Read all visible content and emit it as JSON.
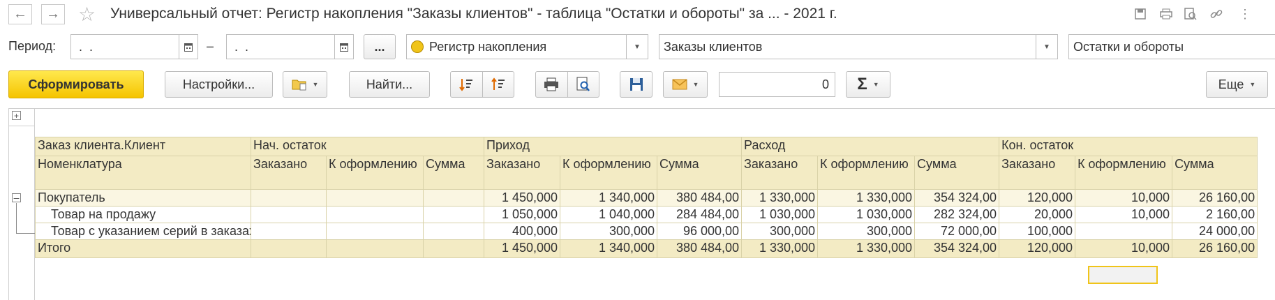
{
  "window": {
    "title": "Универсальный отчет: Регистр накопления \"Заказы клиентов\" - таблица \"Остатки и обороты\" за ... - 2021 г.",
    "back_icon": "arrow-left-icon",
    "forward_icon": "arrow-right-icon",
    "favorite_icon": "star-icon"
  },
  "period": {
    "label": "Период:",
    "from": " .  .",
    "separator": "–",
    "to": " .  .",
    "more_label": "..."
  },
  "source": {
    "type_value": "Регистр накопления",
    "register_value": "Заказы клиентов",
    "table_value": "Остатки и обороты"
  },
  "toolbar": {
    "generate_label": "Сформировать",
    "settings_label": "Настройки...",
    "find_label": "Найти...",
    "sum_value": "0",
    "sigma": "Σ",
    "more_label": "Еще"
  },
  "report": {
    "header1": [
      "Заказ клиента.Клиент",
      "Нач. остаток",
      "Приход",
      "Расход",
      "Кон. остаток"
    ],
    "header2": [
      "Номенклатура",
      "Заказано",
      "К оформлению",
      "Сумма",
      "Заказано",
      "К оформлению",
      "Сумма",
      "Заказано",
      "К оформлению",
      "Сумма",
      "Заказано",
      "К оформлению",
      "Сумма"
    ],
    "group": {
      "name": "Покупатель",
      "values": [
        "",
        "",
        "",
        "1 450,000",
        "1 340,000",
        "380 484,00",
        "1 330,000",
        "1 330,000",
        "354 324,00",
        "120,000",
        "10,000",
        "26 160,00"
      ]
    },
    "rows": [
      {
        "name": "Товар на продажу",
        "values": [
          "",
          "",
          "",
          "1 050,000",
          "1 040,000",
          "284 484,00",
          "1 030,000",
          "1 030,000",
          "282 324,00",
          "20,000",
          "10,000",
          "2 160,00"
        ]
      },
      {
        "name": "Товар с указанием серий в заказах",
        "values": [
          "",
          "",
          "",
          "400,000",
          "300,000",
          "96 000,00",
          "300,000",
          "300,000",
          "72 000,00",
          "100,000",
          "",
          "24 000,00"
        ]
      }
    ],
    "total": {
      "name": "Итого",
      "values": [
        "",
        "",
        "",
        "1 450,000",
        "1 340,000",
        "380 484,00",
        "1 330,000",
        "1 330,000",
        "354 324,00",
        "120,000",
        "10,000",
        "26 160,00"
      ]
    }
  }
}
